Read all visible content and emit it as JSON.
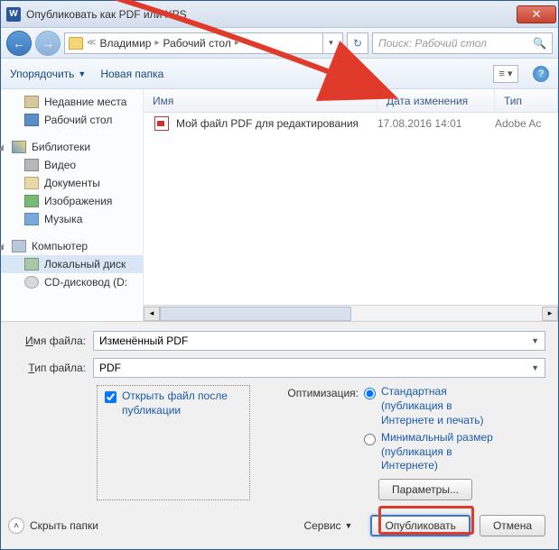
{
  "titlebar": {
    "title": "Опубликовать как PDF или XPS"
  },
  "breadcrumb": {
    "seg1": "Владимир",
    "seg2": "Рабочий стол"
  },
  "search": {
    "placeholder": "Поиск: Рабочий стол"
  },
  "toolbar": {
    "organize": "Упорядочить",
    "new_folder": "Новая папка"
  },
  "sidebar": {
    "recent": "Недавние места",
    "desktop": "Рабочий стол",
    "libraries": "Библиотеки",
    "video": "Видео",
    "documents": "Документы",
    "images": "Изображения",
    "music": "Музыка",
    "computer": "Компьютер",
    "localdisk": "Локальный диск",
    "cd": "CD-дисковод (D:"
  },
  "cols": {
    "name": "Имя",
    "date": "Дата изменения",
    "type": "Тип"
  },
  "files": {
    "row0": {
      "name": "Мой файл PDF для редактирования",
      "date": "17.08.2016 14:01",
      "type": "Adobe Ac"
    }
  },
  "form": {
    "filename_label": "Имя файла:",
    "filename_value": "Изменённый PDF",
    "filetype_label": "Тип файла:",
    "filetype_value": "PDF",
    "open_after": "Открыть файл после публикации",
    "optim_label": "Оптимизация:",
    "standard": "Стандартная (публикация в Интернете и печать)",
    "minimal": "Минимальный размер (публикация в Интернете)",
    "params": "Параметры...",
    "hide": "Скрыть папки",
    "service": "Сервис",
    "publish": "Опубликовать",
    "cancel": "Отмена"
  }
}
